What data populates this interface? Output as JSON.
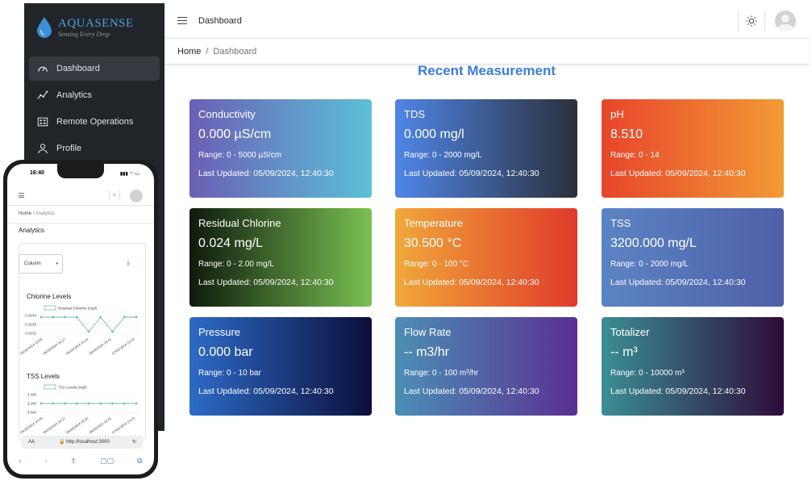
{
  "brand": {
    "name": "AQUASENSE",
    "tagline": "Sensing Every Drop"
  },
  "sidebar": {
    "items": [
      {
        "label": "Dashboard",
        "icon": "speedometer-icon",
        "active": true
      },
      {
        "label": "Analytics",
        "icon": "graph-icon",
        "active": false
      },
      {
        "label": "Remote Operations",
        "icon": "grid-icon",
        "active": false
      },
      {
        "label": "Profile",
        "icon": "user-icon",
        "active": false
      }
    ]
  },
  "topbar": {
    "title": "Dashboard",
    "theme_icon": "sun-icon",
    "avatar_icon": "user-avatar-icon"
  },
  "breadcrumb": {
    "home": "Home",
    "separator": "/",
    "current": "Dashboard"
  },
  "main": {
    "heading": "Recent Measurement",
    "cards": [
      {
        "title": "Conductivity",
        "value": "0.000 µS/cm",
        "range": "Range: 0 - 5000 µS/cm",
        "updated": "Last Updated: 05/09/2024, 12:40:30",
        "gradient": [
          "#6a5fb5",
          "#5bc0d8"
        ]
      },
      {
        "title": "TDS",
        "value": "0.000 mg/l",
        "range": "Range: 0 - 2000 mg/L",
        "updated": "Last Updated: 05/09/2024, 12:40:30",
        "gradient": [
          "#4f86e8",
          "#2b2f3a"
        ]
      },
      {
        "title": "pH",
        "value": "8.510",
        "range": "Range: 0 - 14",
        "updated": "Last Updated: 05/09/2024, 12:40:30",
        "gradient": [
          "#e8452c",
          "#f29a35"
        ]
      },
      {
        "title": "Residual Chlorine",
        "value": "0.024 mg/L",
        "range": "Range: 0 - 2.00 mg/L",
        "updated": "Last Updated: 05/09/2024, 12:40:30",
        "gradient": [
          "#0f1a0c",
          "#79c152"
        ]
      },
      {
        "title": "Temperature",
        "value": "30.500 °C",
        "range": "Range: 0 - 100 °C",
        "updated": "Last Updated: 05/09/2024, 12:40:30",
        "gradient": [
          "#f0a83a",
          "#e03a2a"
        ]
      },
      {
        "title": "TSS",
        "value": "3200.000 mg/L",
        "range": "Range: 0 - 2000 mg/L",
        "updated": "Last Updated: 05/09/2024, 12:40:30",
        "gradient": [
          "#5b84c4",
          "#4f5fa8"
        ]
      },
      {
        "title": "Pressure",
        "value": "0.000 bar",
        "range": "Range: 0 - 10 bar",
        "updated": "Last Updated: 05/09/2024, 12:40:30",
        "gradient": [
          "#2d6bc6",
          "#0b0e3a"
        ]
      },
      {
        "title": "Flow Rate",
        "value": "-- m3/hr",
        "range": "Range: 0 - 100 m³/hr",
        "updated": "Last Updated: 05/09/2024, 12:40:30",
        "gradient": [
          "#4b8fb5",
          "#5b2f92"
        ]
      },
      {
        "title": "Totalizer",
        "value": "-- m³",
        "range": "Range: 0 - 10000 m³",
        "updated": "Last Updated: 05/09/2024, 12:40:30",
        "gradient": [
          "#3a8f93",
          "#2e0b3a"
        ]
      }
    ]
  },
  "mobile": {
    "time": "16:40",
    "status_icons": "▮▮▮ ◠ ▭",
    "breadcrumb_home": "Home",
    "breadcrumb_sep": "/",
    "breadcrumb_current": "Analytics",
    "page_title": "Analytics",
    "chart_type_select": "Column",
    "download_icon": "download-icon",
    "url": "http://localhost:3000",
    "url_aa": "AA",
    "url_lock": "🔒",
    "reload_icon": "↻",
    "toolbar": [
      "‹",
      "›",
      "⇧",
      "▢▢",
      "⧉"
    ]
  },
  "chart_data": [
    {
      "type": "line",
      "title": "Chlorine Levels",
      "series": [
        {
          "name": "Residual Chlorine (mg/l)",
          "values": [
            0.024,
            0.024,
            0.024,
            0.024,
            0.0225,
            0.024,
            0.0225,
            0.024,
            0.024
          ]
        }
      ],
      "y_ticks": [
        "0.0240",
        "0.0230",
        "0.0220"
      ],
      "ylim": [
        0.022,
        0.0245
      ],
      "x_labels": [
        "05/28/2024 15:09",
        "06/28/2024 16:17",
        "06/28/2024 15:24",
        "08/28/2024 16:41",
        "07/01/2024 14:19"
      ],
      "color": "#6bbfb2"
    },
    {
      "type": "line",
      "title": "TSS Levels",
      "series": [
        {
          "name": "TSS Levels (mg/l)",
          "values": [
            3.2,
            3.2,
            3.2,
            3.2,
            3.2,
            3.2,
            3.2,
            3.2,
            3.2
          ]
        }
      ],
      "y_ticks": [
        "3.400",
        "3.200",
        "3.000"
      ],
      "ylim": [
        2.9,
        3.5
      ],
      "x_labels": [
        "05/28/2024 15:09",
        "06/28/2024 16:17",
        "06/28/2024 15:24",
        "08/28/2024 16:41",
        "07/01/2024 14:19"
      ],
      "color": "#6bbfb2"
    }
  ]
}
